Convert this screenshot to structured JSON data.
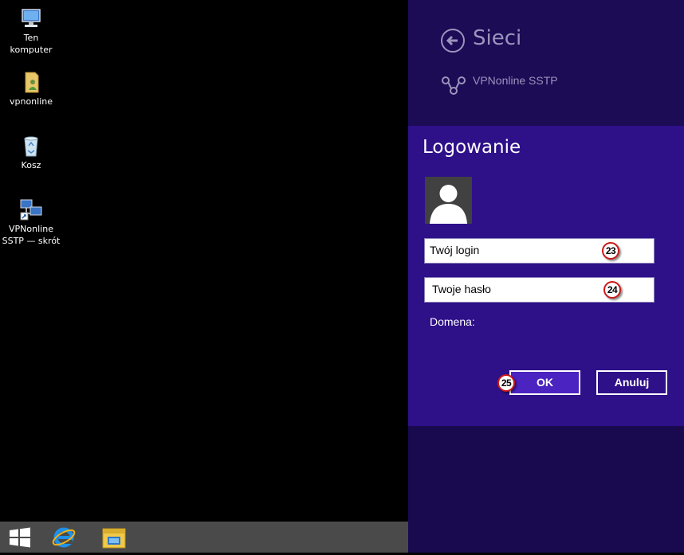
{
  "desktop": {
    "icons": [
      {
        "label1": "Ten",
        "label2": "komputer",
        "icon": "computer-icon"
      },
      {
        "label1": "vpnonline",
        "label2": "",
        "icon": "folder-user-icon"
      },
      {
        "label1": "Kosz",
        "label2": "",
        "icon": "recycle-bin-icon"
      },
      {
        "label1": "VPNonline",
        "label2": "SSTP — skrót",
        "icon": "network-shortcut-icon"
      }
    ]
  },
  "taskbar": {
    "items": [
      "windows-start-icon",
      "internet-explorer-icon",
      "file-explorer-icon"
    ]
  },
  "charm": {
    "title": "Sieci",
    "connection_name": "VPNonline SSTP",
    "login": {
      "title": "Logowanie",
      "login_value": "Twój login",
      "password_value": "Twoje hasło",
      "domain_label": "Domena:",
      "ok_label": "OK",
      "cancel_label": "Anuluj"
    },
    "annotations": {
      "login": "23",
      "password": "24",
      "ok": "25"
    }
  },
  "colors": {
    "charm_bg": "#190a4f",
    "dialog_bg": "#2e1089",
    "ok_bg": "#4b23c0",
    "badge_border": "#cc1a1a",
    "taskbar_bg": "#4a4a4a"
  }
}
